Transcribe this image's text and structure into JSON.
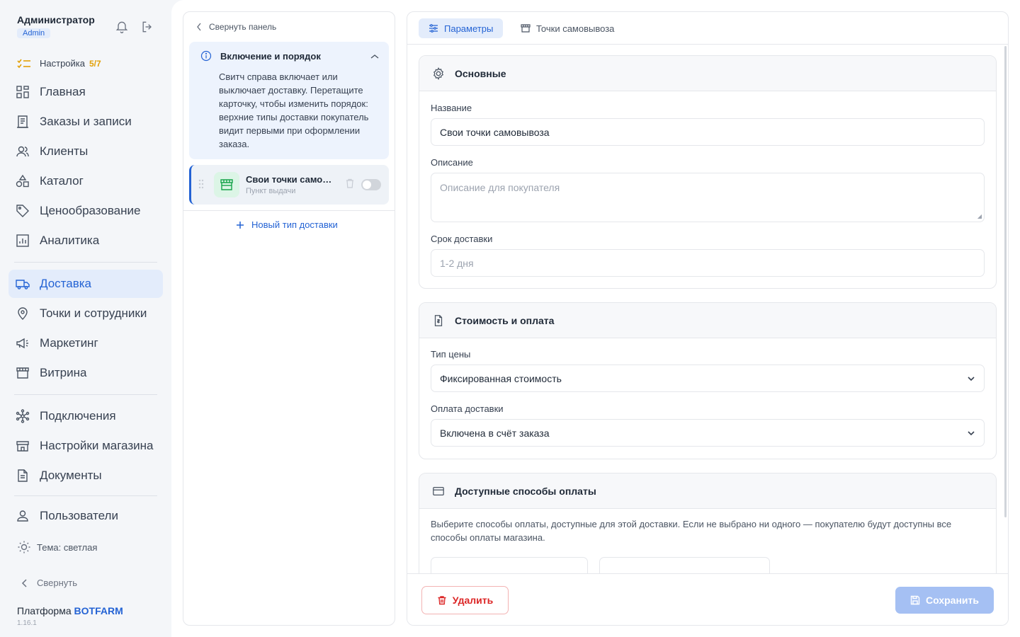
{
  "user": {
    "name": "Администратор",
    "role": "Admin"
  },
  "setup": {
    "label": "Настройка",
    "progress": "5/7"
  },
  "nav": {
    "home": "Главная",
    "orders": "Заказы и записи",
    "clients": "Клиенты",
    "catalog": "Каталог",
    "pricing": "Ценообразование",
    "analytics": "Аналитика",
    "delivery": "Доставка",
    "points": "Точки и сотрудники",
    "marketing": "Маркетинг",
    "showcase": "Витрина",
    "connections": "Подключения",
    "store_settings": "Настройки магазина",
    "documents": "Документы",
    "users": "Пользователи"
  },
  "theme": "Тема: светлая",
  "collapse": "Свернуть",
  "platform": {
    "prefix": "Платформа",
    "brand": "BOTFARM",
    "version": "1.16.1"
  },
  "mid": {
    "collapse": "Свернуть панель",
    "info_title": "Включение и порядок",
    "info_text": "Свитч справа включает или выключает доставку. Перетащите карточку, чтобы изменить порядок: верхние типы доставки покупатель видит первыми при оформлении заказа.",
    "item": {
      "name": "Свои точки самовывоза",
      "sub": "Пункт выдачи",
      "enabled": false
    },
    "new_type": "Новый тип доставки"
  },
  "tabs": {
    "params": "Параметры",
    "pickup": "Точки самовывоза"
  },
  "basic": {
    "title": "Основные",
    "name_label": "Название",
    "name_value": "Свои точки самовывоза",
    "desc_label": "Описание",
    "desc_placeholder": "Описание для покупателя",
    "term_label": "Срок доставки",
    "term_placeholder": "1-2 дня"
  },
  "cost": {
    "title": "Стоимость и оплата",
    "price_type_label": "Тип цены",
    "price_type_value": "Фиксированная стоимость",
    "payment_label": "Оплата доставки",
    "payment_value": "Включена в счёт заказа"
  },
  "pay": {
    "title": "Доступные способы оплаты",
    "text": "Выберите способы оплаты, доступные для этой доставки. Если не выбрано ни одного — покупателю будут доступны все способы оплаты магазина."
  },
  "footer": {
    "delete": "Удалить",
    "save": "Сохранить"
  },
  "colors": {
    "accent": "#2463d4",
    "danger": "#dc2626",
    "save_disabled": "#a5c0f3",
    "success": "#16a34a"
  }
}
